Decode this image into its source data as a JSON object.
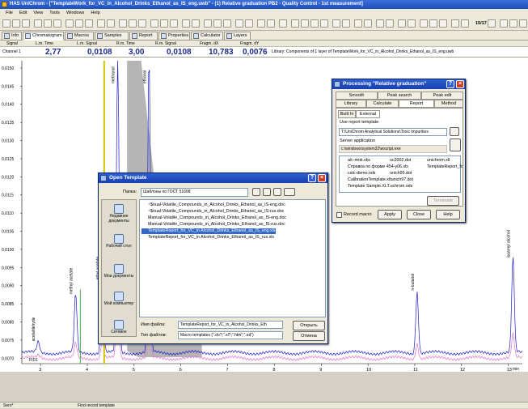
{
  "app": {
    "title": "HAS UniChrom - [\"TemplateWork_for_VC_in_Alcohol_Drinks_Ethanol_as_IS_eng.uwb\" - (1) Relative graduation PB2 - Quality Control - 1st measurement]"
  },
  "menu": [
    "File",
    "Edit",
    "View",
    "Tools",
    "Windows",
    "Help"
  ],
  "toolbar": {
    "counter": "15/17"
  },
  "tabs": [
    "Info",
    "Chromatogram",
    "Macros",
    "Samples",
    "Report",
    "Properties",
    "Calculator",
    "Layers"
  ],
  "header": {
    "cols": [
      "Signal",
      "L.m. Time",
      "L.m. Signal",
      "R.m. Time",
      "R.m. Signal",
      "Fragm. dX",
      "Fragm. dY"
    ],
    "channel": "Channel 1",
    "values": [
      "2,77",
      "0,0108",
      "3,00",
      "0,0108",
      "10,783",
      "0,0076"
    ],
    "library": "Library: Components of 1 layer of TemplateWork_for_VC_in_Alcohol_Drinks_Ethanol_as_IS_eng.uwb"
  },
  "chart_data": {
    "type": "line",
    "xlabel": "min",
    "ylabel": "",
    "x_ticks": [
      "3",
      "4",
      "5",
      "6",
      "7",
      "8",
      "9",
      "10",
      "11",
      "12",
      "13"
    ],
    "y_ticks": [
      "0,0150",
      "0,0145",
      "0,0140",
      "0,0135",
      "0,0130",
      "0,0125",
      "0,0120",
      "0,0115",
      "0,0110",
      "0,0105",
      "0,0100",
      "0,0095",
      "0,0090",
      "0,0085",
      "0,0080",
      "0,0075",
      "0,0070"
    ],
    "xlim": [
      2.6,
      13.3
    ],
    "ylim": [
      0.00685,
      0.0152
    ],
    "baseline_label": "FID1",
    "peaks": [
      {
        "name": "acetaldehyde",
        "x": 2.95,
        "y": 0.0074
      },
      {
        "name": "methyl acetate",
        "x": 3.75,
        "y": 0.0087
      },
      {
        "name": "ethyl acetate",
        "x": 4.32,
        "y": 0.0091
      },
      {
        "name": "methanol",
        "x": 4.65,
        "y": 0.0152
      },
      {
        "name": "ethanol",
        "x": 5.32,
        "y": 0.0152
      },
      {
        "name": "n-butanol",
        "x": 11.05,
        "y": 0.0088
      },
      {
        "name": "isoamyl alcohol",
        "x": 13.1,
        "y": 0.0097
      }
    ],
    "series": [
      {
        "name": "",
        "color": "#1a1acd"
      },
      {
        "name": "",
        "color": "#e070c8"
      }
    ]
  },
  "processing": {
    "title": "Processing \"Relative graduation\"",
    "tabs_row1": [
      "Smooth",
      "Peak search",
      "Peak edit"
    ],
    "tabs_row2": [
      "Library",
      "Calculate",
      "Report",
      "Method"
    ],
    "subtabs": [
      "Built In",
      "External"
    ],
    "use_report_template": "Use report template",
    "template_path": "T:\\UniChrom Analytical Solutions\\Toxic impurities",
    "server_app": "Server application",
    "server_path": "c:\\windows\\system32\\wscript.exe",
    "files": [
      "alc-mok.vbc",
      "uc2002.dot",
      "unichrom.xll",
      "Справка по форме 454-у06.xls",
      "TemplateReport_fc",
      "calc-demo.ods",
      "unich95.dot",
      "CalibrationTemplate.xltunich97.dot",
      "Template Sample.XLT.uchrom.ods"
    ],
    "terminate": "Terminate",
    "record_macro": "Record macro",
    "apply": "Apply",
    "close": "Close",
    "help": "Help"
  },
  "open_template": {
    "title": "Open Template",
    "folder_label": "Папка:",
    "folder": "Шаблоны по ГОСТ 51698",
    "places": [
      "Недавние документы",
      "Рабочий стол",
      "Мои документы",
      "Мой компьютер",
      "Сетевое"
    ],
    "files": [
      "~$nual-Volatile_Compounds_in_Alcohol_Drinks_Ethanol_as_IS-eng.doc",
      "~$nual-Volatile_Compounds_in_Alcohol_Drinks_Ethanol_as_IS-rus.doc",
      "Manual-Volatile_Compounds_in_Alcohol_Drinks_Ethanol_as_IS-eng.doc",
      "Manual-Volatile_Compounds_in_Alcohol_Drinks_Ethanol_as_IS-rus.doc",
      "TemplateReport_for_VC_in Alcohol_Drinks_Ethanol_as_IS_eng.xls",
      "TemplateReport_for_VC_in Alcohol_Drinks_Ethanol_as_IS_rus.xls"
    ],
    "filename_label": "Имя файла:",
    "filename": "TemplateReport_for_VC_in_Alcohol_Drinks_Eth",
    "filetype_label": "Тип файлов:",
    "filetype": "Macro templates (\".do?;\".xl?;\".htm\";\".od\")",
    "open": "Открыть",
    "cancel": "Отмена"
  },
  "status": {
    "left": "Sero*",
    "right": "Find record template"
  }
}
